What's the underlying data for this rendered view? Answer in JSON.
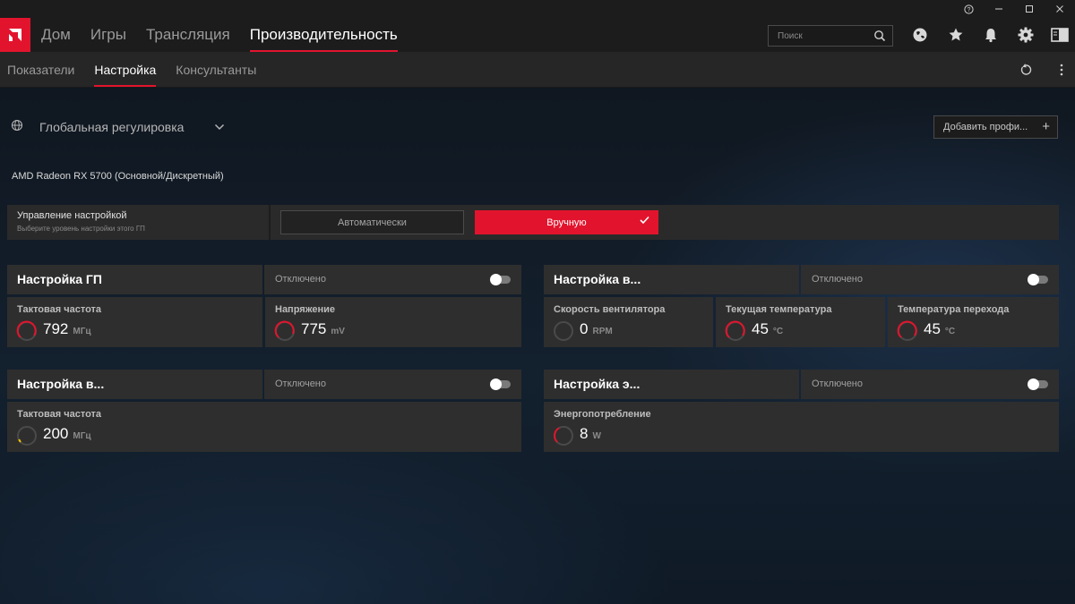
{
  "window": {
    "help": "?",
    "minimize": "—",
    "maximize": "□",
    "close": "✕"
  },
  "nav": {
    "tabs": [
      {
        "label": "Дом"
      },
      {
        "label": "Игры"
      },
      {
        "label": "Трансляция"
      },
      {
        "label": "Производительность"
      }
    ],
    "search_placeholder": "Поиск"
  },
  "subnav": {
    "tabs": [
      {
        "label": "Показатели"
      },
      {
        "label": "Настройка"
      },
      {
        "label": "Консультанты"
      }
    ]
  },
  "profile": {
    "label": "Глобальная регулировка",
    "add_button": "Добавить профи...",
    "add_icon": "+"
  },
  "gpu": {
    "name": "AMD Radeon RX 5700 (Основной/Дискретный)"
  },
  "control": {
    "title": "Управление настройкой",
    "subtitle": "Выберите уровень настройки этого ГП",
    "auto_label": "Автоматически",
    "manual_label": "Вручную"
  },
  "panels": {
    "gpu_tuning": {
      "title": "Настройка ГП",
      "status": "Отключено",
      "metrics": [
        {
          "label": "Тактовая частота",
          "value": "792",
          "unit": "МГц"
        },
        {
          "label": "Напряжение",
          "value": "775",
          "unit": "mV"
        }
      ]
    },
    "fan_tuning": {
      "title": "Настройка в...",
      "status": "Отключено",
      "metrics": [
        {
          "label": "Скорость вентилятора",
          "value": "0",
          "unit": "RPM"
        },
        {
          "label": "Текущая температура",
          "value": "45",
          "unit": "°C"
        },
        {
          "label": "Температура перехода",
          "value": "45",
          "unit": "°C"
        }
      ]
    },
    "vram_tuning": {
      "title": "Настройка в...",
      "status": "Отключено",
      "metrics": [
        {
          "label": "Тактовая частота",
          "value": "200",
          "unit": "МГц"
        }
      ]
    },
    "power_tuning": {
      "title": "Настройка э...",
      "status": "Отключено",
      "metrics": [
        {
          "label": "Энергопотребление",
          "value": "8",
          "unit": "W"
        }
      ]
    }
  },
  "colors": {
    "accent": "#e2142d",
    "gauge_yellow": "#f5c400",
    "gauge_track": "#4a4a4a"
  }
}
